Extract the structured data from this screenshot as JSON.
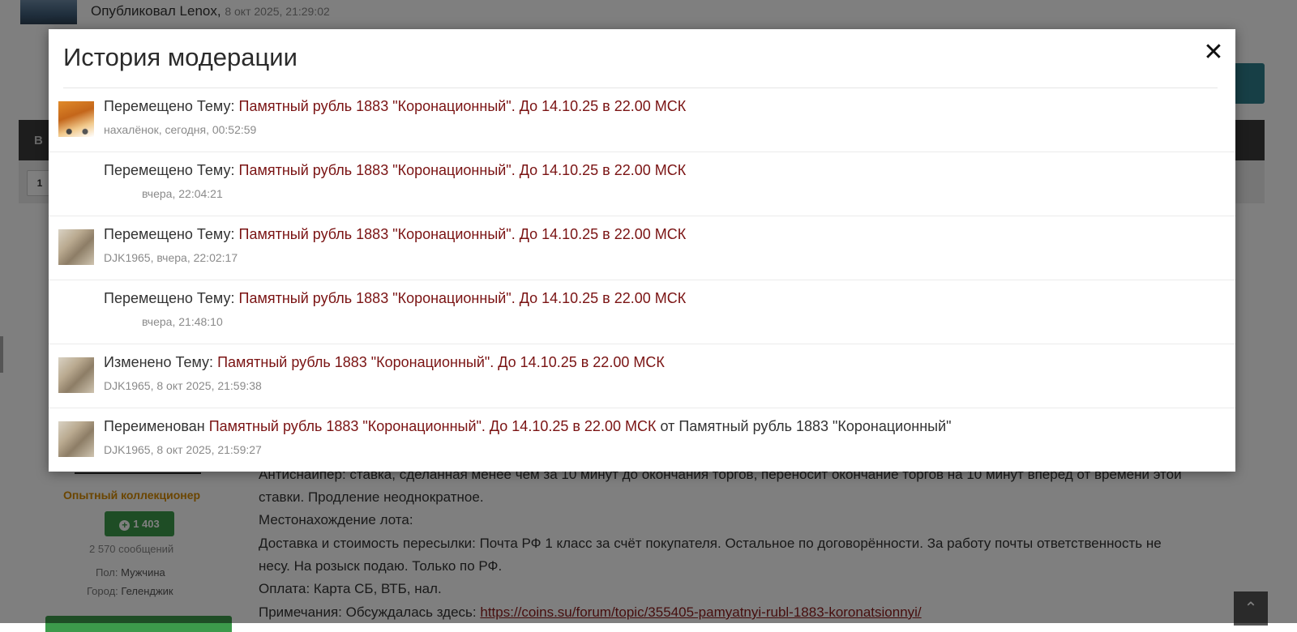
{
  "background": {
    "published_label": "Опубликовал",
    "published_author": "Lenox",
    "published_date": "8 окт 2025, 21:29:02",
    "darkbar_letter": "В",
    "page_button": "1",
    "user_rank": "Опытный коллекционер",
    "reputation": "1 403",
    "posts_count": "2 570 сообщений",
    "gender_label": "Пол:",
    "gender_value": "Мужчина",
    "city_label": "Город:",
    "city_value": "Геленджик",
    "text_line_1": "Антиснайпер: ставка, сделанная менее чем за 10 минут до окончания торгов, переносит окончание торгов на 10 минут вперед от времени этой",
    "text_line_2": "ставки. Продление неоднократное.",
    "text_line_3": "Местонахождение лота:",
    "text_line_4": "Доставка и стоимость пересылки: Почта РФ 1 класс за счёт покупателя. Остальное по договорённости. За работу почты ответственность не",
    "text_line_5": "несу. На розыск подаю. Только по РФ.",
    "text_line_6": "Оплата: Карта СБ, ВТБ, нал.",
    "notes_label": "Примечания: Обсуждалась здесь:",
    "notes_link": "https://coins.su/forum/topic/355405-pamyatnyi-rubl-1883-koronatsionnyi/"
  },
  "modal": {
    "title": "История модерации",
    "close_icon": "close-icon",
    "items": [
      {
        "avatar": "tiger",
        "action": "Перемещено Тему:",
        "topic": "Памятный рубль 1883 \"Коронационный\". До 14.10.25 в 22.00 МСК",
        "suffix": "",
        "meta": "нахалёнок, сегодня, 00:52:59"
      },
      {
        "avatar": "none",
        "action": "Перемещено Тему:",
        "topic": "Памятный рубль 1883 \"Коронационный\". До 14.10.25 в 22.00 МСК",
        "suffix": "",
        "meta": "вчера, 22:04:21"
      },
      {
        "avatar": "photo",
        "action": "Перемещено Тему:",
        "topic": "Памятный рубль 1883 \"Коронационный\". До 14.10.25 в 22.00 МСК",
        "suffix": "",
        "meta": "DJK1965, вчера, 22:02:17"
      },
      {
        "avatar": "none",
        "action": "Перемещено Тему:",
        "topic": "Памятный рубль 1883 \"Коронационный\". До 14.10.25 в 22.00 МСК",
        "suffix": "",
        "meta": "вчера, 21:48:10"
      },
      {
        "avatar": "photo",
        "action": "Изменено Тему:",
        "topic": "Памятный рубль 1883 \"Коронационный\". До 14.10.25 в 22.00 МСК",
        "suffix": "",
        "meta": "DJK1965, 8 окт 2025, 21:59:38"
      },
      {
        "avatar": "photo",
        "action": "Переименован",
        "topic": "Памятный рубль 1883 \"Коронационный\". До 14.10.25 в 22.00 МСК",
        "suffix": "от Памятный рубль 1883 \"Коронационный\"",
        "meta": "DJK1965, 8 окт 2025, 21:59:27"
      }
    ]
  },
  "colors": {
    "topic_link": "#7a1313",
    "rank": "#d68b00",
    "reputation_bg": "#3c9a4b"
  }
}
